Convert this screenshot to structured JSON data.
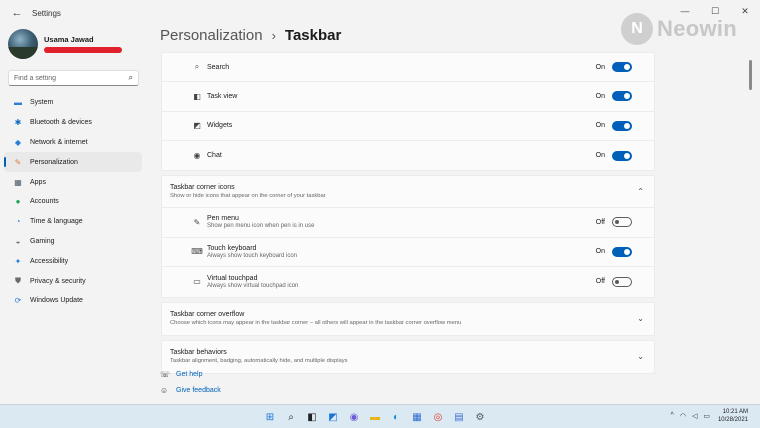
{
  "window": {
    "title": "Settings",
    "back_glyph": "←",
    "controls": [
      "—",
      "☐",
      "✕"
    ]
  },
  "profile": {
    "name": "Usama Jawad"
  },
  "search": {
    "placeholder": "Find a setting"
  },
  "nav": [
    {
      "label": "System",
      "icon": "monitor-icon",
      "color": "#2b7fd6",
      "glyph": "▬"
    },
    {
      "label": "Bluetooth & devices",
      "icon": "bluetooth-icon",
      "color": "#0f6cbd",
      "glyph": "✱"
    },
    {
      "label": "Network & internet",
      "icon": "wifi-icon",
      "color": "#2b7fd6",
      "glyph": "◆"
    },
    {
      "label": "Personalization",
      "icon": "brush-icon",
      "color": "#e07a3a",
      "glyph": "✎",
      "active": true
    },
    {
      "label": "Apps",
      "icon": "apps-icon",
      "color": "#4a5a68",
      "glyph": "▦"
    },
    {
      "label": "Accounts",
      "icon": "person-icon",
      "color": "#19a05a",
      "glyph": "●"
    },
    {
      "label": "Time & language",
      "icon": "globe-clock-icon",
      "color": "#2b7fd6",
      "glyph": "◔"
    },
    {
      "label": "Gaming",
      "icon": "controller-icon",
      "color": "#6b6b6b",
      "glyph": "◒"
    },
    {
      "label": "Accessibility",
      "icon": "accessibility-icon",
      "color": "#2b7fd6",
      "glyph": "✦"
    },
    {
      "label": "Privacy & security",
      "icon": "shield-icon",
      "color": "#6b6b6b",
      "glyph": "⛊"
    },
    {
      "label": "Windows Update",
      "icon": "update-icon",
      "color": "#2b7fd6",
      "glyph": "⟳"
    }
  ],
  "heading": {
    "crumb": "Personalization",
    "separator": "›",
    "page": "Taskbar"
  },
  "taskbar_items": [
    {
      "label": "Search",
      "state": "On",
      "on": true,
      "icon": "search-icon",
      "glyph": "⌕"
    },
    {
      "label": "Task view",
      "state": "On",
      "on": true,
      "icon": "task-view-icon",
      "glyph": "◧"
    },
    {
      "label": "Widgets",
      "state": "On",
      "on": true,
      "icon": "widgets-icon",
      "glyph": "◩"
    },
    {
      "label": "Chat",
      "state": "On",
      "on": true,
      "icon": "chat-icon",
      "glyph": "◉"
    }
  ],
  "corner_icons": {
    "title": "Taskbar corner icons",
    "subtitle": "Show or hide icons that appear on the corner of your taskbar",
    "chevron": "⌃",
    "items": [
      {
        "label": "Pen menu",
        "sub": "Show pen menu icon when pen is in use",
        "state": "Off",
        "on": false,
        "icon": "pen-icon",
        "glyph": "✎"
      },
      {
        "label": "Touch keyboard",
        "sub": "Always show touch keyboard icon",
        "state": "On",
        "on": true,
        "icon": "keyboard-icon",
        "glyph": "⌨"
      },
      {
        "label": "Virtual touchpad",
        "sub": "Always show virtual touchpad icon",
        "state": "Off",
        "on": false,
        "icon": "touchpad-icon",
        "glyph": "▭"
      }
    ]
  },
  "corner_overflow": {
    "title": "Taskbar corner overflow",
    "subtitle": "Choose which icons may appear in the taskbar corner – all others will appear in the taskbar corner overflow menu",
    "chevron": "⌄"
  },
  "behaviors": {
    "title": "Taskbar behaviors",
    "subtitle": "Taskbar alignment, badging, automatically hide, and multiple displays",
    "chevron": "⌄"
  },
  "links": [
    {
      "label": "Get help",
      "icon": "help-icon",
      "glyph": "☏"
    },
    {
      "label": "Give feedback",
      "icon": "feedback-icon",
      "glyph": "☺"
    }
  ],
  "watermark": {
    "text": "Neowin",
    "logo_glyph": "N"
  },
  "system_taskbar": {
    "apps": [
      {
        "name": "start-icon",
        "glyph": "⊞",
        "color": "#1a73d9"
      },
      {
        "name": "search-icon",
        "glyph": "⌕",
        "color": "#222"
      },
      {
        "name": "task-view-icon",
        "glyph": "◧",
        "color": "#222"
      },
      {
        "name": "widgets-icon",
        "glyph": "◩",
        "color": "#1a73d9"
      },
      {
        "name": "chat-icon",
        "glyph": "◉",
        "color": "#6b5bd6"
      },
      {
        "name": "file-explorer-icon",
        "glyph": "▬",
        "color": "#e8b520"
      },
      {
        "name": "edge-icon",
        "glyph": "◐",
        "color": "#1b8bd6"
      },
      {
        "name": "store-icon",
        "glyph": "▦",
        "color": "#2a6bd1"
      },
      {
        "name": "chrome-icon",
        "glyph": "◎",
        "color": "#d93b2b"
      },
      {
        "name": "notes-icon",
        "glyph": "▤",
        "color": "#3d6fd1"
      },
      {
        "name": "settings-icon",
        "glyph": "⚙",
        "color": "#555"
      }
    ],
    "tray": [
      {
        "name": "chevron-up-icon",
        "glyph": "^"
      },
      {
        "name": "wifi-icon",
        "glyph": "◠"
      },
      {
        "name": "volume-icon",
        "glyph": "◁"
      },
      {
        "name": "battery-icon",
        "glyph": "▭"
      }
    ],
    "time": "10:21 AM",
    "date": "10/28/2021"
  }
}
